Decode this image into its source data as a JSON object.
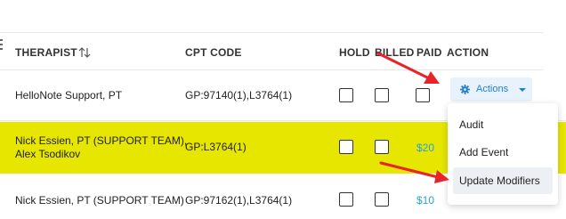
{
  "columns": {
    "therapist": "THERAPIST",
    "cpt_code": "CPT CODE",
    "hold": "HOLD",
    "billed": "BILLED",
    "paid": "PAID",
    "action": "ACTION"
  },
  "rows": [
    {
      "therapist_line1": "HelloNote Support, PT",
      "therapist_line2": "",
      "cpt_code": "GP:97140(1),L3764(1)",
      "paid": ""
    },
    {
      "therapist_line1": "Nick Essien, PT (SUPPORT TEAM),",
      "therapist_line2": "Alex Tsodikov",
      "cpt_code": "GP:L3764(1)",
      "paid": "$20"
    },
    {
      "therapist_line1": "Nick Essien, PT (SUPPORT TEAM)",
      "therapist_line2": "",
      "cpt_code": "GP:97162(1),L3764(1)",
      "paid": "$10"
    }
  ],
  "actions_button": {
    "label": "Actions",
    "icon": "gear-icon"
  },
  "actions_menu": [
    "Audit",
    "Add Event",
    "Update Modifiers"
  ],
  "colors": {
    "highlight_row": "#e6e600",
    "accent_blue": "#1e7fd0",
    "paid_text": "#29a3d6",
    "annotation_arrow": "#e8232a"
  }
}
